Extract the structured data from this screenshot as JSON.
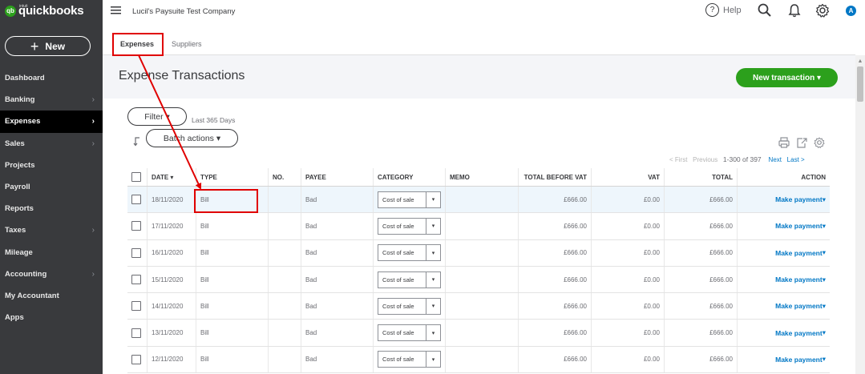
{
  "sidebar": {
    "logo_intuit": "intuit",
    "logo_text": "quickbooks",
    "logo_mark": "qb",
    "new_button": {
      "plus": "+",
      "label": "New"
    },
    "items": [
      {
        "label": "Dashboard",
        "chevron": false
      },
      {
        "label": "Banking",
        "chevron": true
      },
      {
        "label": "Expenses",
        "chevron": true,
        "active": true
      },
      {
        "label": "Sales",
        "chevron": true
      },
      {
        "label": "Projects",
        "chevron": false
      },
      {
        "label": "Payroll",
        "chevron": false
      },
      {
        "label": "Reports",
        "chevron": false
      },
      {
        "label": "Taxes",
        "chevron": true
      },
      {
        "label": "Mileage",
        "chevron": false
      },
      {
        "label": "Accounting",
        "chevron": true
      },
      {
        "label": "My Accountant",
        "chevron": false
      },
      {
        "label": "Apps",
        "chevron": false
      }
    ],
    "chevron_char": "›"
  },
  "header": {
    "menu_icon": "hamburger-icon",
    "company": "Lucil's Paysuite Test Company",
    "help_label": "Help",
    "help_icon": "?",
    "avatar_initial": "A"
  },
  "tabs": [
    {
      "label": "Expenses",
      "active": true
    },
    {
      "label": "Suppliers",
      "active": false
    }
  ],
  "main": {
    "title": "Expense Transactions",
    "new_transaction": "New transaction ▾",
    "filter_label": "Filter ▾",
    "filter_summary": "Last 365 Days",
    "batch_actions": "Batch actions ▾",
    "pager": {
      "first": "< First",
      "previous": "Previous",
      "range": "1-300 of 397",
      "next": "Next",
      "last": "Last >"
    }
  },
  "table": {
    "columns": [
      "",
      "DATE ▾",
      "TYPE",
      "NO.",
      "PAYEE",
      "CATEGORY",
      "MEMO",
      "TOTAL BEFORE VAT",
      "VAT",
      "TOTAL",
      "ACTION"
    ],
    "rows": [
      {
        "date": "18/11/2020",
        "type": "Bill",
        "no": "",
        "payee": "Bad",
        "category": "Cost of sale",
        "memo": "",
        "before_vat": "£666.00",
        "vat": "£0.00",
        "total": "£666.00",
        "action": "Make payment"
      },
      {
        "date": "17/11/2020",
        "type": "Bill",
        "no": "",
        "payee": "Bad",
        "category": "Cost of sale",
        "memo": "",
        "before_vat": "£666.00",
        "vat": "£0.00",
        "total": "£666.00",
        "action": "Make payment"
      },
      {
        "date": "16/11/2020",
        "type": "Bill",
        "no": "",
        "payee": "Bad",
        "category": "Cost of sale",
        "memo": "",
        "before_vat": "£666.00",
        "vat": "£0.00",
        "total": "£666.00",
        "action": "Make payment"
      },
      {
        "date": "15/11/2020",
        "type": "Bill",
        "no": "",
        "payee": "Bad",
        "category": "Cost of sale",
        "memo": "",
        "before_vat": "£666.00",
        "vat": "£0.00",
        "total": "£666.00",
        "action": "Make payment"
      },
      {
        "date": "14/11/2020",
        "type": "Bill",
        "no": "",
        "payee": "Bad",
        "category": "Cost of sale",
        "memo": "",
        "before_vat": "£666.00",
        "vat": "£0.00",
        "total": "£666.00",
        "action": "Make payment"
      },
      {
        "date": "13/11/2020",
        "type": "Bill",
        "no": "",
        "payee": "Bad",
        "category": "Cost of sale",
        "memo": "",
        "before_vat": "£666.00",
        "vat": "£0.00",
        "total": "£666.00",
        "action": "Make payment"
      },
      {
        "date": "12/11/2020",
        "type": "Bill",
        "no": "",
        "payee": "Bad",
        "category": "Cost of sale",
        "memo": "",
        "before_vat": "£666.00",
        "vat": "£0.00",
        "total": "£666.00",
        "action": "Make payment"
      }
    ],
    "select_arrow": "▾",
    "action_arrow": "▾"
  },
  "colors": {
    "sidebar_bg": "#393a3d",
    "brand_green": "#2ca01c",
    "link_blue": "#0077c5",
    "annotation_red": "#e00000"
  }
}
